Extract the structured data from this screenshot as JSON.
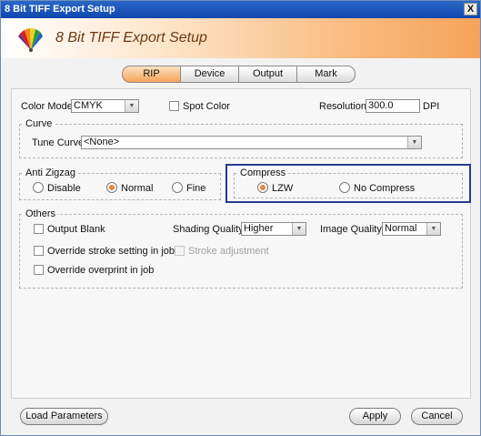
{
  "window": {
    "title": "8 Bit TIFF Export Setup",
    "close_label": "X"
  },
  "header": {
    "title": "8 Bit TIFF Export Setup",
    "logo_icon": "color-fan-icon"
  },
  "tabs": [
    {
      "label": "RIP",
      "active": true
    },
    {
      "label": "Device",
      "active": false
    },
    {
      "label": "Output",
      "active": false
    },
    {
      "label": "Mark",
      "active": false
    }
  ],
  "rip": {
    "color_mode_label": "Color Mode:",
    "color_mode_value": "CMYK",
    "spot_color_label": "Spot Color",
    "spot_color_checked": false,
    "resolution_label": "Resolution:",
    "resolution_value": "300.0",
    "resolution_unit": "DPI"
  },
  "curve": {
    "group_label": "Curve",
    "tune_curve_label": "Tune Curve:",
    "tune_curve_value": "<None>"
  },
  "anti_zigzag": {
    "group_label": "Anti Zigzag",
    "options": [
      {
        "label": "Disable",
        "selected": false
      },
      {
        "label": "Normal",
        "selected": true
      },
      {
        "label": "Fine",
        "selected": false
      }
    ]
  },
  "compress": {
    "group_label": "Compress",
    "options": [
      {
        "label": "LZW",
        "selected": true
      },
      {
        "label": "No Compress",
        "selected": false
      }
    ]
  },
  "others": {
    "group_label": "Others",
    "output_blank_label": "Output Blank",
    "shading_quality_label": "Shading Quality:",
    "shading_quality_value": "Higher",
    "image_quality_label": "Image Quality:",
    "image_quality_value": "Normal",
    "override_stroke_label": "Override stroke setting in job",
    "stroke_adjustment_label": "Stroke adjustment",
    "override_overprint_label": "Override overprint in job"
  },
  "footer": {
    "load_parameters_label": "Load Parameters",
    "apply_label": "Apply",
    "cancel_label": "Cancel"
  },
  "colors": {
    "accent_orange": "#e8843a",
    "titlebar_blue": "#1047b0",
    "highlight_border": "#2b3990"
  }
}
